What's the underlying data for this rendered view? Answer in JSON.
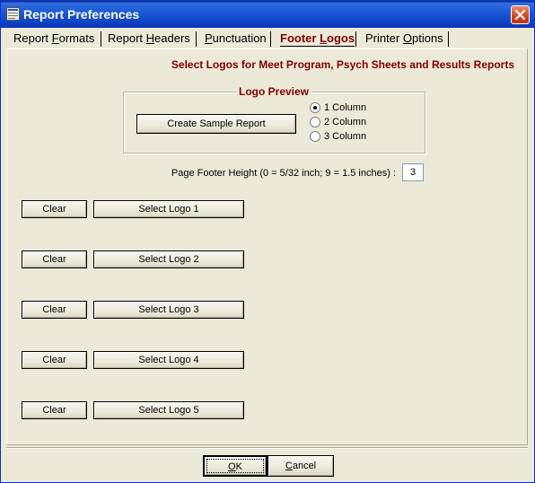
{
  "window": {
    "title": "Report Preferences"
  },
  "tabs": [
    {
      "pre": "Report ",
      "acc": "F",
      "post": "ormats",
      "active": false
    },
    {
      "pre": "Report ",
      "acc": "H",
      "post": "eaders",
      "active": false
    },
    {
      "pre": "",
      "acc": "P",
      "post": "unctuation",
      "active": false
    },
    {
      "pre": "Footer ",
      "acc": "L",
      "post": "ogos",
      "active": true
    },
    {
      "pre": "Printer ",
      "acc": "O",
      "post": "ptions",
      "active": false
    }
  ],
  "heading": "Select Logos for Meet Program, Psych Sheets and Results Reports",
  "preview": {
    "group_title": "Logo Preview",
    "sample_button": "Create Sample Report",
    "options": [
      {
        "label": "1 Column",
        "checked": true
      },
      {
        "label": "2 Column",
        "checked": false
      },
      {
        "label": "3 Column",
        "checked": false
      }
    ]
  },
  "footer_height": {
    "label": "Page Footer Height (0 = 5/32 inch; 9 = 1.5 inches) :",
    "value": "3"
  },
  "logos": [
    {
      "clear": "Clear",
      "select": "Select Logo 1"
    },
    {
      "clear": "Clear",
      "select": "Select Logo 2"
    },
    {
      "clear": "Clear",
      "select": "Select Logo 3"
    },
    {
      "clear": "Clear",
      "select": "Select Logo 4"
    },
    {
      "clear": "Clear",
      "select": "Select Logo 5"
    }
  ],
  "buttons": {
    "ok": {
      "acc": "O",
      "post": "K"
    },
    "cancel": {
      "pre": "",
      "acc": "C",
      "post": "ancel"
    }
  },
  "colors": {
    "accent": "#800000",
    "titlebar": "#0b3fc1",
    "face": "#ece9d8"
  }
}
